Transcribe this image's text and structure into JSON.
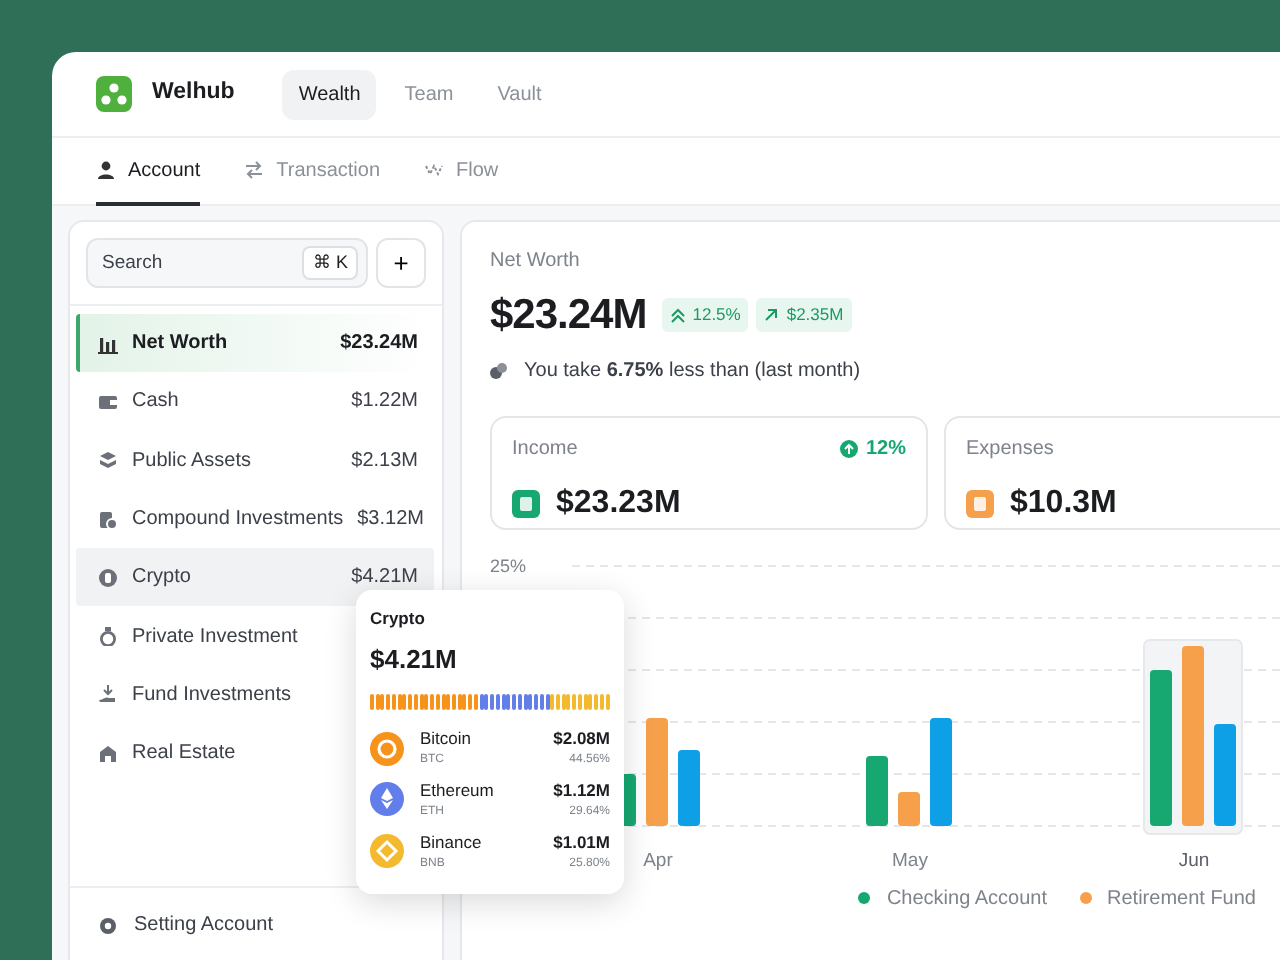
{
  "app": {
    "name": "Welhub"
  },
  "top_tabs": [
    {
      "label": "Wealth",
      "selected": true
    },
    {
      "label": "Team",
      "selected": false
    },
    {
      "label": "Vault",
      "selected": false
    }
  ],
  "sub_tabs": [
    {
      "label": "Account",
      "selected": true
    },
    {
      "label": "Transaction",
      "selected": false
    },
    {
      "label": "Flow",
      "selected": false
    }
  ],
  "sidebar": {
    "search": {
      "placeholder": "Search",
      "shortcut": "⌘ K"
    },
    "add_button": "+",
    "items": [
      {
        "label": "Net Worth",
        "value": "$23.24M",
        "selected": true,
        "hovered": false
      },
      {
        "label": "Cash",
        "value": "$1.22M",
        "selected": false,
        "hovered": false
      },
      {
        "label": "Public Assets",
        "value": "$2.13M",
        "selected": false,
        "hovered": false
      },
      {
        "label": "Compound Investments",
        "value": "$3.12M",
        "selected": false,
        "hovered": false
      },
      {
        "label": "Crypto",
        "value": "$4.21M",
        "selected": false,
        "hovered": true
      },
      {
        "label": "Private Investment",
        "value": "",
        "selected": false,
        "hovered": false
      },
      {
        "label": "Fund Investments",
        "value": "",
        "selected": false,
        "hovered": false
      },
      {
        "label": "Real Estate",
        "value": "",
        "selected": false,
        "hovered": false
      }
    ],
    "footer": "Setting Account"
  },
  "net_worth": {
    "label": "Net Worth",
    "amount": "$23.24M",
    "badges": [
      "12.5%",
      "$2.35M"
    ],
    "note": "You take **6.75%** less than (last month)"
  },
  "cards": [
    {
      "label": "Income",
      "amount": "$23.23M",
      "change": "12%",
      "color": "#16a870"
    },
    {
      "label": "Expenses",
      "amount": "$10.3M",
      "color": "#f7a04b"
    }
  ],
  "chart": {
    "y_tick": "25%",
    "months": [
      {
        "label": "Apr",
        "selected": false
      },
      {
        "label": "May",
        "selected": false
      },
      {
        "label": "Jun",
        "selected": true
      }
    ],
    "legend": [
      {
        "label": "Checking Account",
        "color": "#16a870"
      },
      {
        "label": "Retirement Fund",
        "color": "#f7a04b"
      }
    ]
  },
  "tooltip": {
    "title": "Crypto",
    "amount": "$4.21M",
    "coins": [
      {
        "name": "Bitcoin",
        "symbol": "BTC",
        "value": "$2.08M",
        "share": "44.56%",
        "color": "#f7931a"
      },
      {
        "name": "Ethereum",
        "symbol": "ETH",
        "value": "$1.12M",
        "share": "29.64%",
        "color": "#627eea"
      },
      {
        "name": "Binance",
        "symbol": "BNB",
        "value": "$1.01M",
        "share": "25.80%",
        "color": "#f3ba2f"
      }
    ]
  }
}
